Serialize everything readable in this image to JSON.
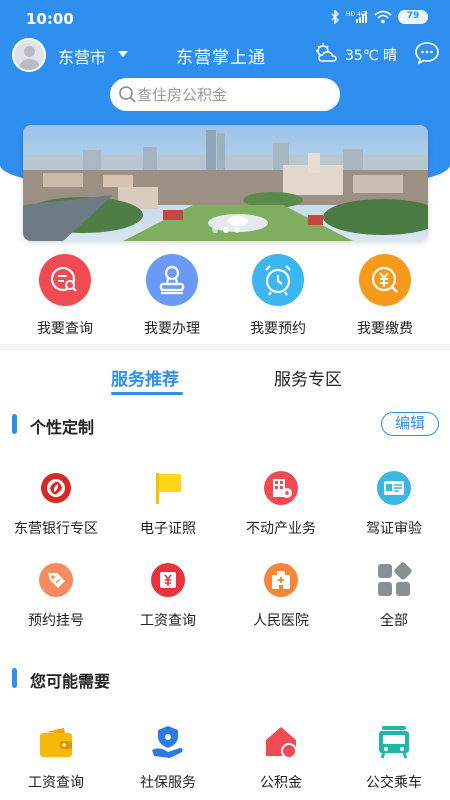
{
  "status_bar": {
    "time": "10:00",
    "network": "HD 4G",
    "battery": "79"
  },
  "header": {
    "city": "东营市",
    "title": "东营掌上通",
    "weather": "35℃ 晴"
  },
  "search": {
    "placeholder": "查住房公积金"
  },
  "quick_actions": [
    {
      "label": "我要查询",
      "icon": "search-doc-icon",
      "color": "#f04a52"
    },
    {
      "label": "我要办理",
      "icon": "stamp-icon",
      "color": "#6b9af5"
    },
    {
      "label": "我要预约",
      "icon": "alarm-clock-icon",
      "color": "#3cb6f3"
    },
    {
      "label": "我要缴费",
      "icon": "yuan-icon",
      "color": "#f59a1b"
    }
  ],
  "tabs": [
    {
      "label": "服务推荐",
      "active": true
    },
    {
      "label": "服务专区",
      "active": false
    }
  ],
  "custom_section": {
    "title": "个性定制",
    "edit_label": "编辑",
    "items": [
      {
        "label": "东营银行专区",
        "icon": "bank-logo-icon"
      },
      {
        "label": "电子证照",
        "icon": "flag-icon"
      },
      {
        "label": "不动产业务",
        "icon": "building-icon"
      },
      {
        "label": "驾证审验",
        "icon": "license-card-icon"
      },
      {
        "label": "预约挂号",
        "icon": "tag-icon"
      },
      {
        "label": "工资查询",
        "icon": "salary-icon"
      },
      {
        "label": "人民医院",
        "icon": "hospital-icon"
      },
      {
        "label": "全部",
        "icon": "all-apps-icon"
      }
    ]
  },
  "maybe_section": {
    "title": "您可能需要",
    "items": [
      {
        "label": "工资查询",
        "icon": "wallet-icon"
      },
      {
        "label": "社保服务",
        "icon": "social-security-icon"
      },
      {
        "label": "公积金",
        "icon": "house-fund-icon"
      },
      {
        "label": "公交乘车",
        "icon": "bus-icon"
      }
    ]
  }
}
